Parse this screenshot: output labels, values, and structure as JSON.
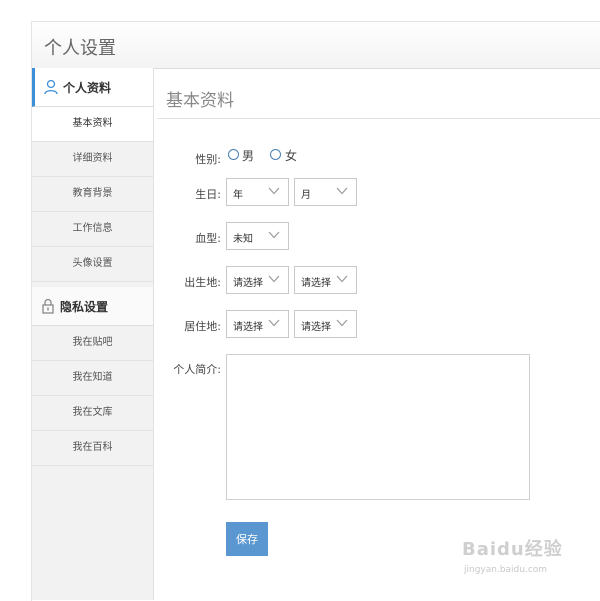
{
  "header": {
    "title": "个人设置"
  },
  "sidebar": {
    "profile_section": "个人资料",
    "profile_items": [
      "基本资料",
      "详细资料",
      "教育背景",
      "工作信息",
      "头像设置"
    ],
    "privacy_section": "隐私设置",
    "privacy_items": [
      "我在贴吧",
      "我在知道",
      "我在文库",
      "我在百科"
    ],
    "accent_color": "#3d8fd9"
  },
  "content": {
    "title": "基本资料",
    "gender": {
      "label": "性别:",
      "options": [
        "男",
        "女"
      ]
    },
    "birthday": {
      "label": "生日:",
      "year": "年",
      "month": "月"
    },
    "blood_type": {
      "label": "血型:",
      "value": "未知"
    },
    "birthplace": {
      "label": "出生地:",
      "province": "请选择",
      "city": "请选择"
    },
    "residence": {
      "label": "居住地:",
      "province": "请选择",
      "city": "请选择"
    },
    "bio": {
      "label": "个人简介:",
      "value": ""
    },
    "save_label": "保存",
    "save_color": "#5a96cf"
  },
  "watermark": {
    "brand": "Baidu经验",
    "url": "jingyan.baidu.com"
  }
}
